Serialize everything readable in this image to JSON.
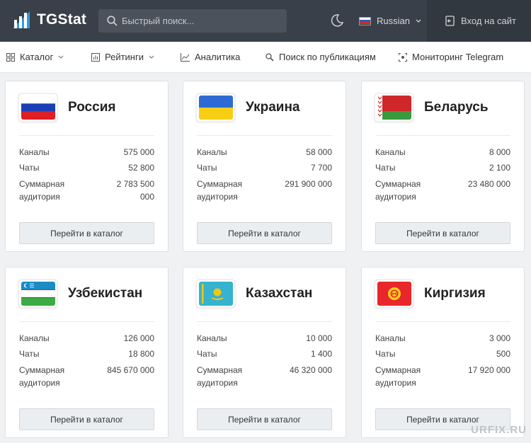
{
  "header": {
    "logo_text": "TGStat",
    "search_placeholder": "Быстрый поиск...",
    "language": "Russian",
    "login": "Вход на сайт"
  },
  "nav": {
    "catalog": "Каталог",
    "ratings": "Рейтинги",
    "analytics": "Аналитика",
    "post_search": "Поиск по публикациям",
    "monitoring": "Мониторинг Telegram"
  },
  "labels": {
    "channels": "Каналы",
    "chats": "Чаты",
    "audience": "Суммарная аудитория",
    "button": "Перейти в каталог"
  },
  "countries": [
    {
      "name": "Россия",
      "channels": "575 000",
      "chats": "52 800",
      "audience": "2 783 500 000"
    },
    {
      "name": "Украина",
      "channels": "58 000",
      "chats": "7 700",
      "audience": "291 900 000"
    },
    {
      "name": "Беларусь",
      "channels": "8 000",
      "chats": "2 100",
      "audience": "23 480 000"
    },
    {
      "name": "Узбекистан",
      "channels": "126 000",
      "chats": "18 800",
      "audience": "845 670 000"
    },
    {
      "name": "Казахстан",
      "channels": "10 000",
      "chats": "1 400",
      "audience": "46 320 000"
    },
    {
      "name": "Киргизия",
      "channels": "3 000",
      "chats": "500",
      "audience": "17 920 000"
    }
  ],
  "watermark": "URFIX.RU"
}
